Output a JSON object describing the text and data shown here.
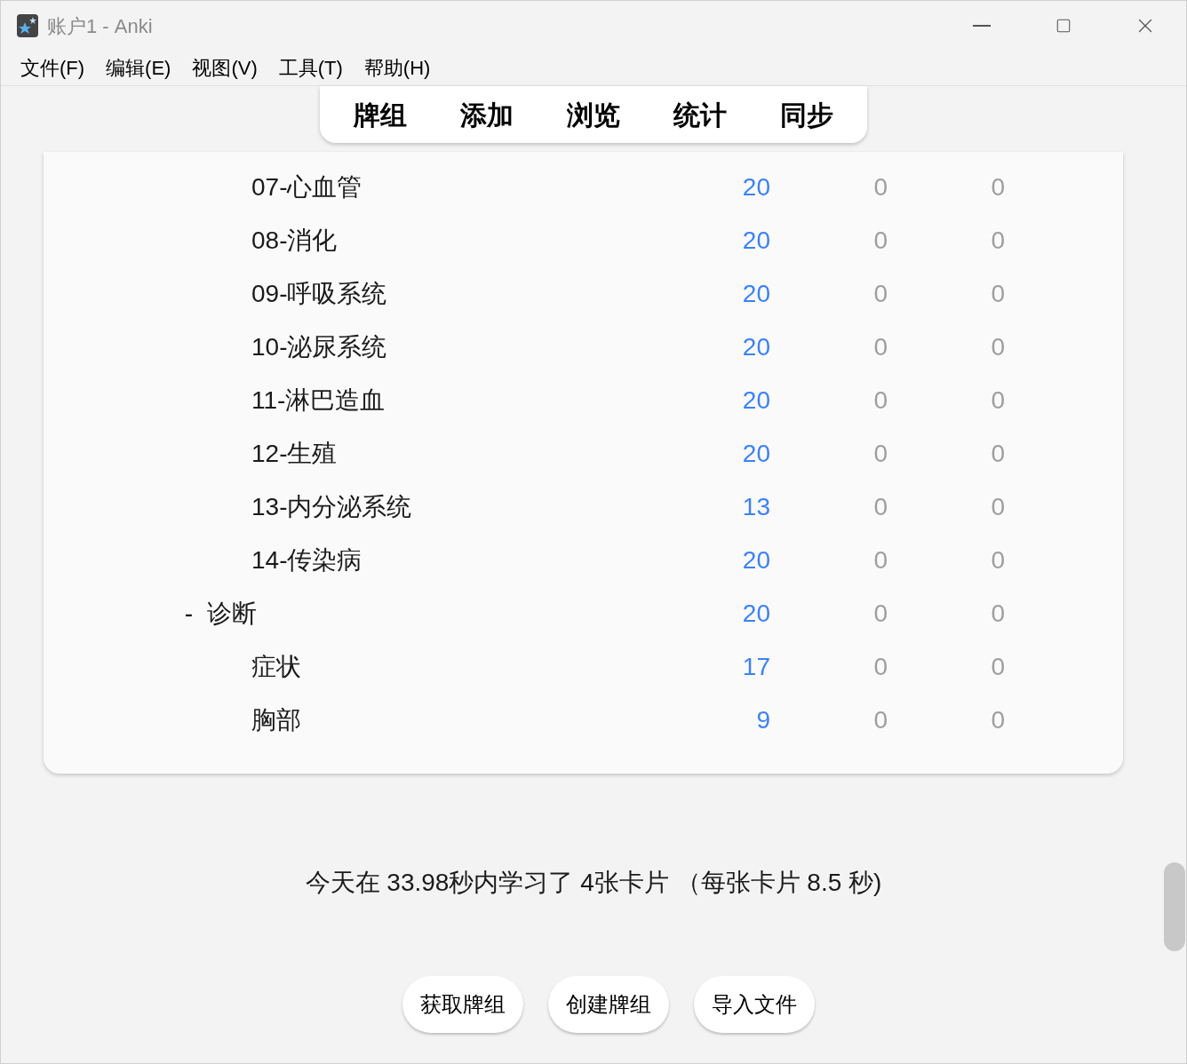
{
  "window": {
    "title": "账户1 - Anki"
  },
  "menu": [
    "文件(F)",
    "编辑(E)",
    "视图(V)",
    "工具(T)",
    "帮助(H)"
  ],
  "toolbar": [
    "牌组",
    "添加",
    "浏览",
    "统计",
    "同步"
  ],
  "decks": [
    {
      "children": [
        {
          "name": "07-心血管",
          "due": "20",
          "new": "0",
          "learn": "0"
        },
        {
          "name": "08-消化",
          "due": "20",
          "new": "0",
          "learn": "0"
        },
        {
          "name": "09-呼吸系统",
          "due": "20",
          "new": "0",
          "learn": "0"
        },
        {
          "name": "10-泌尿系统",
          "due": "20",
          "new": "0",
          "learn": "0"
        },
        {
          "name": "11-淋巴造血",
          "due": "20",
          "new": "0",
          "learn": "0"
        },
        {
          "name": "12-生殖",
          "due": "20",
          "new": "0",
          "learn": "0"
        },
        {
          "name": "13-内分泌系统",
          "due": "13",
          "new": "0",
          "learn": "0"
        },
        {
          "name": "14-传染病",
          "due": "20",
          "new": "0",
          "learn": "0"
        }
      ]
    },
    {
      "name": "诊断",
      "expander": "-",
      "due": "20",
      "new": "0",
      "learn": "0",
      "children": [
        {
          "name": "症状",
          "due": "17",
          "new": "0",
          "learn": "0"
        },
        {
          "name": "胸部",
          "due": "9",
          "new": "0",
          "learn": "0"
        }
      ]
    }
  ],
  "stats": "今天在 33.98秒内学习了 4张卡片 （每张卡片 8.5 秒)",
  "buttons": [
    "获取牌组",
    "创建牌组",
    "导入文件"
  ]
}
